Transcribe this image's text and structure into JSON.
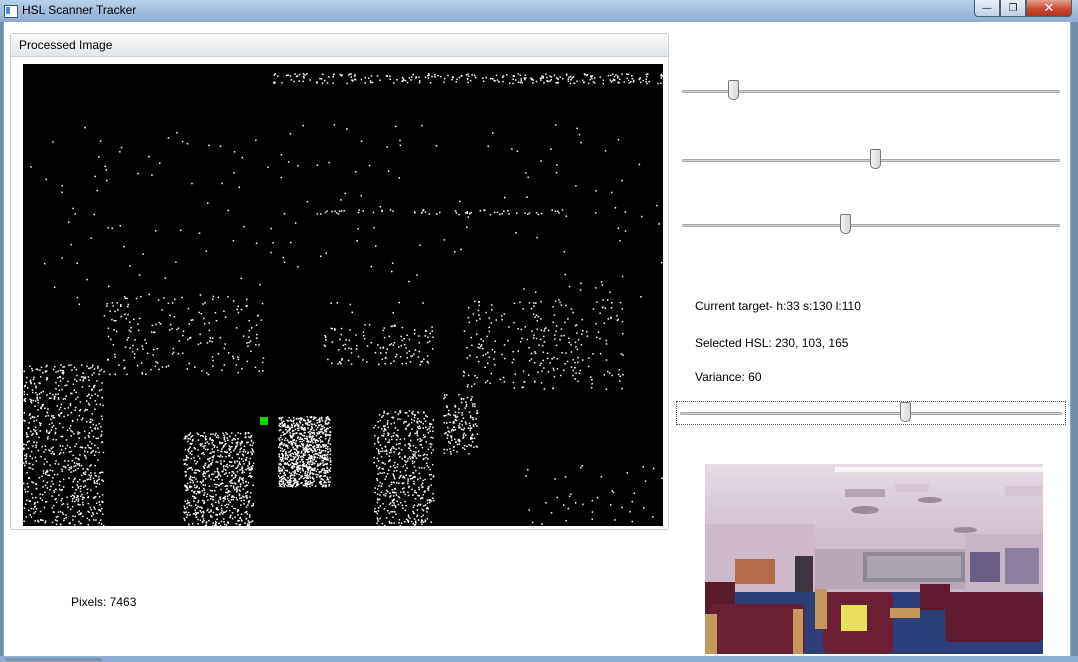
{
  "window": {
    "title": "HSL Scanner Tracker",
    "min_glyph": "—",
    "max_glyph": "❐",
    "close_glyph": "✕"
  },
  "groupbox": {
    "header": "Processed Image"
  },
  "marker": {
    "color": "#00dd00"
  },
  "sliders": [
    {
      "name": "hue-slider",
      "value_fraction": 0.13
    },
    {
      "name": "saturation-slider",
      "value_fraction": 0.51
    },
    {
      "name": "lightness-slider",
      "value_fraction": 0.43
    },
    {
      "name": "variance-slider",
      "value_fraction": 0.59
    }
  ],
  "info": {
    "current_target": "Current target- h:33 s:130 l:110",
    "selected_hsl": "Selected HSL: 230, 103, 165",
    "variance": "Variance: 60"
  },
  "status": {
    "pixels": "Pixels: 7463"
  }
}
